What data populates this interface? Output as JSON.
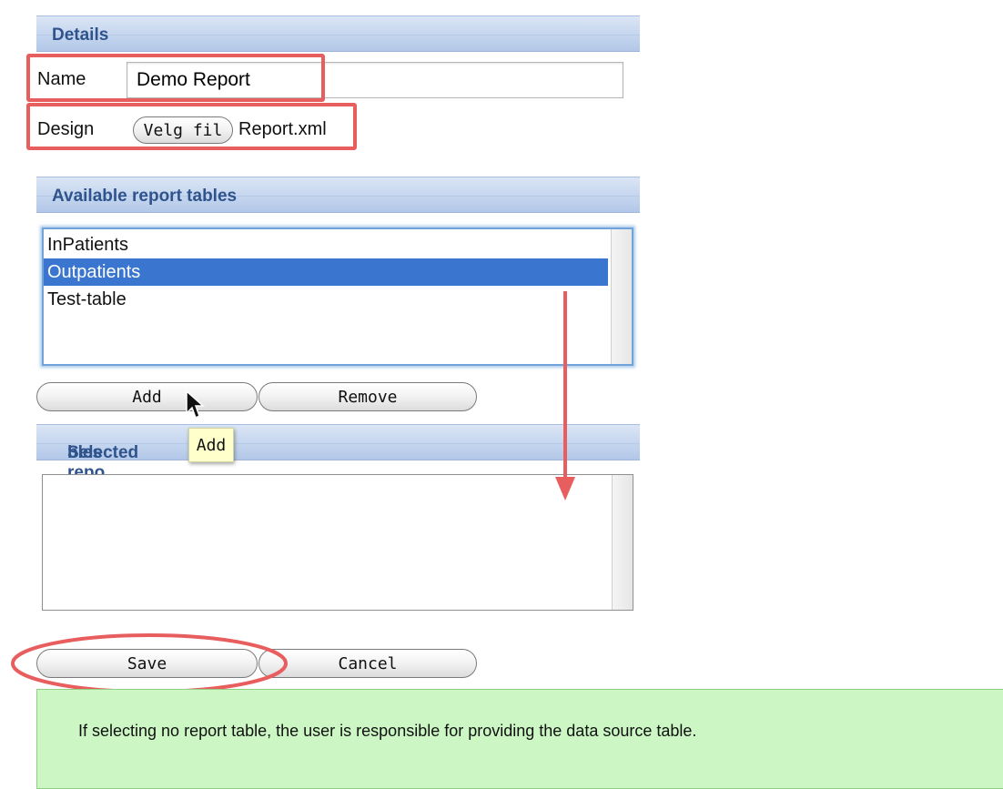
{
  "details": {
    "header": "Details",
    "name_label": "Name",
    "name_value": "Demo Report",
    "design_label": "Design",
    "file_button": "Velg fil",
    "file_name": "Report.xml"
  },
  "available": {
    "header": "Available report tables",
    "items": [
      "InPatients",
      "Outpatients",
      "Test-table"
    ],
    "selected_index": 1
  },
  "actions": {
    "add": "Add",
    "remove": "Remove",
    "tooltip": "Add"
  },
  "selected": {
    "header_before": "Selected repo",
    "header_after": "bles",
    "items": []
  },
  "footer": {
    "save": "Save",
    "cancel": "Cancel"
  },
  "note": {
    "text": "If selecting no report table, the user is responsible for providing the data source table."
  },
  "colors": {
    "annotation": "#e85d5d",
    "selection": "#3a75d0",
    "header_text": "#2f538c",
    "note_bg": "#ccf7c4"
  }
}
